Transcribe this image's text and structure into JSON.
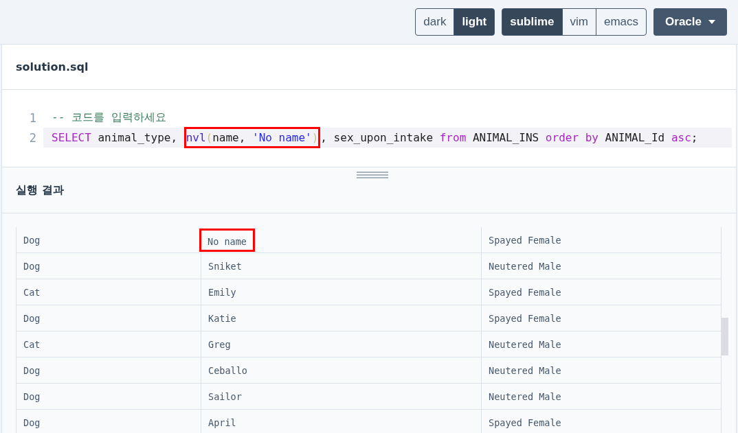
{
  "toolbar": {
    "themes": [
      {
        "label": "dark",
        "selected": false
      },
      {
        "label": "light",
        "selected": true
      }
    ],
    "keymaps": [
      {
        "label": "sublime",
        "selected": true
      },
      {
        "label": "vim",
        "selected": false
      },
      {
        "label": "emacs",
        "selected": false
      }
    ],
    "language": {
      "label": "Oracle"
    }
  },
  "editor": {
    "filename": "solution.sql",
    "lines": [
      {
        "number": "1",
        "current": false,
        "tokens": [
          {
            "text": "-- 코드를 입력하세요",
            "kind": "comment",
            "boxed": false
          }
        ]
      },
      {
        "number": "2",
        "current": true,
        "tokens": [
          {
            "text": "SELECT",
            "kind": "keyword",
            "boxed": false
          },
          {
            "text": " animal_type, ",
            "kind": "plain",
            "boxed": false
          },
          {
            "text": "nvl",
            "kind": "function",
            "boxed": true
          },
          {
            "text": "(",
            "kind": "bracket",
            "boxed": true
          },
          {
            "text": "name, ",
            "kind": "plain",
            "boxed": true
          },
          {
            "text": "'No name'",
            "kind": "string",
            "boxed": true
          },
          {
            "text": ")",
            "kind": "bracket",
            "boxed": true
          },
          {
            "text": ", sex_upon_intake ",
            "kind": "plain",
            "boxed": false
          },
          {
            "text": "from",
            "kind": "keyword",
            "boxed": false
          },
          {
            "text": " ANIMAL_INS ",
            "kind": "plain",
            "boxed": false
          },
          {
            "text": "order by",
            "kind": "keyword",
            "boxed": false
          },
          {
            "text": " ANIMAL_Id ",
            "kind": "plain",
            "boxed": false
          },
          {
            "text": "asc",
            "kind": "keyword",
            "boxed": false
          },
          {
            "text": ";",
            "kind": "plain",
            "boxed": false
          }
        ]
      }
    ]
  },
  "result": {
    "title": "실행 결과",
    "rows": [
      {
        "cells": [
          {
            "text": "Dog",
            "boxed": false
          },
          {
            "text": "No name",
            "boxed": true
          },
          {
            "text": "Spayed Female",
            "boxed": false
          }
        ]
      },
      {
        "cells": [
          {
            "text": "Dog",
            "boxed": false
          },
          {
            "text": "Sniket",
            "boxed": false
          },
          {
            "text": "Neutered Male",
            "boxed": false
          }
        ]
      },
      {
        "cells": [
          {
            "text": "Cat",
            "boxed": false
          },
          {
            "text": "Emily",
            "boxed": false
          },
          {
            "text": "Spayed Female",
            "boxed": false
          }
        ]
      },
      {
        "cells": [
          {
            "text": "Dog",
            "boxed": false
          },
          {
            "text": "Katie",
            "boxed": false
          },
          {
            "text": "Spayed Female",
            "boxed": false
          }
        ]
      },
      {
        "cells": [
          {
            "text": "Cat",
            "boxed": false
          },
          {
            "text": "Greg",
            "boxed": false
          },
          {
            "text": "Neutered Male",
            "boxed": false
          }
        ]
      },
      {
        "cells": [
          {
            "text": "Dog",
            "boxed": false
          },
          {
            "text": "Ceballo",
            "boxed": false
          },
          {
            "text": "Neutered Male",
            "boxed": false
          }
        ]
      },
      {
        "cells": [
          {
            "text": "Dog",
            "boxed": false
          },
          {
            "text": "Sailor",
            "boxed": false
          },
          {
            "text": "Neutered Male",
            "boxed": false
          }
        ]
      },
      {
        "cells": [
          {
            "text": "Dog",
            "boxed": false
          },
          {
            "text": "April",
            "boxed": false
          },
          {
            "text": "Spayed Female",
            "boxed": false
          }
        ]
      }
    ]
  }
}
